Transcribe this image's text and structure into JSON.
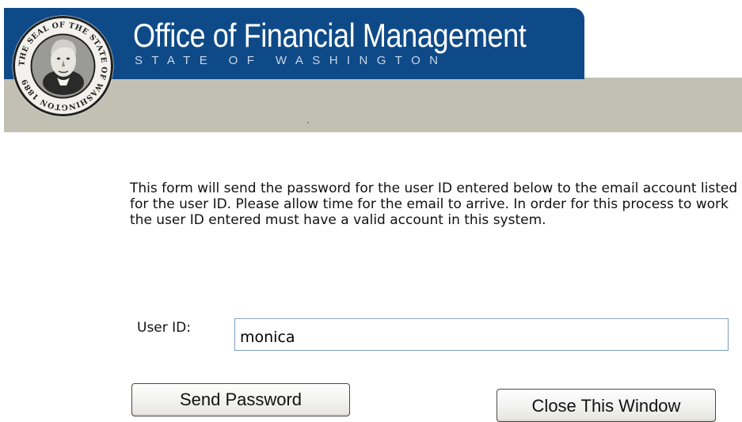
{
  "header": {
    "title": "Office of Financial Management",
    "subtitle": "STATE OF WASHINGTON",
    "seal_icon": "state-of-washington-seal",
    "seal_text": "THE SEAL OF THE STATE OF WASHINGTON 1889",
    "colors": {
      "banner_blue": "#0f4a88",
      "banner_gray": "#c2c0b3"
    }
  },
  "form": {
    "instructions": "This form will send the password for the user ID entered below to the email account listed for the user ID. Please allow time for the email to arrive. In order for this process to work the user ID entered must have a valid account in this system.",
    "user_id_label": "User ID:",
    "user_id_value": "monica",
    "send_button_label": "Send Password",
    "close_button_label": "Close This Window"
  }
}
